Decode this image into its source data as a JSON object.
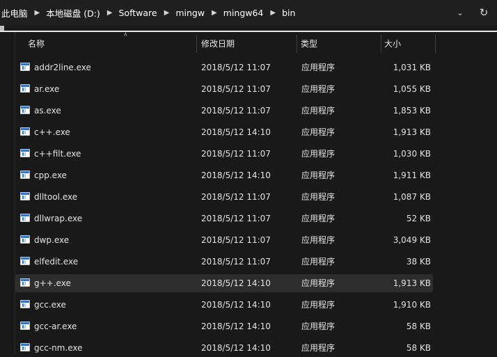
{
  "breadcrumb": [
    "此电脑",
    "本地磁盘 (D:)",
    "Software",
    "mingw",
    "mingw64",
    "bin"
  ],
  "columns": {
    "name": "名称",
    "date": "修改日期",
    "type": "类型",
    "size": "大小"
  },
  "files": [
    {
      "name": "addr2line.exe",
      "date": "2018/5/12 11:07",
      "type": "应用程序",
      "size": "1,031 KB"
    },
    {
      "name": "ar.exe",
      "date": "2018/5/12 11:07",
      "type": "应用程序",
      "size": "1,055 KB"
    },
    {
      "name": "as.exe",
      "date": "2018/5/12 11:07",
      "type": "应用程序",
      "size": "1,853 KB"
    },
    {
      "name": "c++.exe",
      "date": "2018/5/12 14:10",
      "type": "应用程序",
      "size": "1,913 KB"
    },
    {
      "name": "c++filt.exe",
      "date": "2018/5/12 11:07",
      "type": "应用程序",
      "size": "1,030 KB"
    },
    {
      "name": "cpp.exe",
      "date": "2018/5/12 14:10",
      "type": "应用程序",
      "size": "1,911 KB"
    },
    {
      "name": "dlltool.exe",
      "date": "2018/5/12 11:07",
      "type": "应用程序",
      "size": "1,087 KB"
    },
    {
      "name": "dllwrap.exe",
      "date": "2018/5/12 11:07",
      "type": "应用程序",
      "size": "52 KB"
    },
    {
      "name": "dwp.exe",
      "date": "2018/5/12 11:07",
      "type": "应用程序",
      "size": "3,049 KB"
    },
    {
      "name": "elfedit.exe",
      "date": "2018/5/12 11:07",
      "type": "应用程序",
      "size": "38 KB"
    },
    {
      "name": "g++.exe",
      "date": "2018/5/12 14:10",
      "type": "应用程序",
      "size": "1,913 KB"
    },
    {
      "name": "gcc.exe",
      "date": "2018/5/12 14:10",
      "type": "应用程序",
      "size": "1,910 KB"
    },
    {
      "name": "gcc-ar.exe",
      "date": "2018/5/12 14:10",
      "type": "应用程序",
      "size": "58 KB"
    },
    {
      "name": "gcc-nm.exe",
      "date": "2018/5/12 14:10",
      "type": "应用程序",
      "size": "58 KB"
    }
  ],
  "selected_file": "g++.exe",
  "icons": {
    "chevron": "chevron-down-icon",
    "refresh": "refresh-icon",
    "file": "exe-file-icon"
  },
  "colors": {
    "background": "#191919",
    "selected_row": "#2d2d2d",
    "icon_accent": "#2a78d4"
  }
}
